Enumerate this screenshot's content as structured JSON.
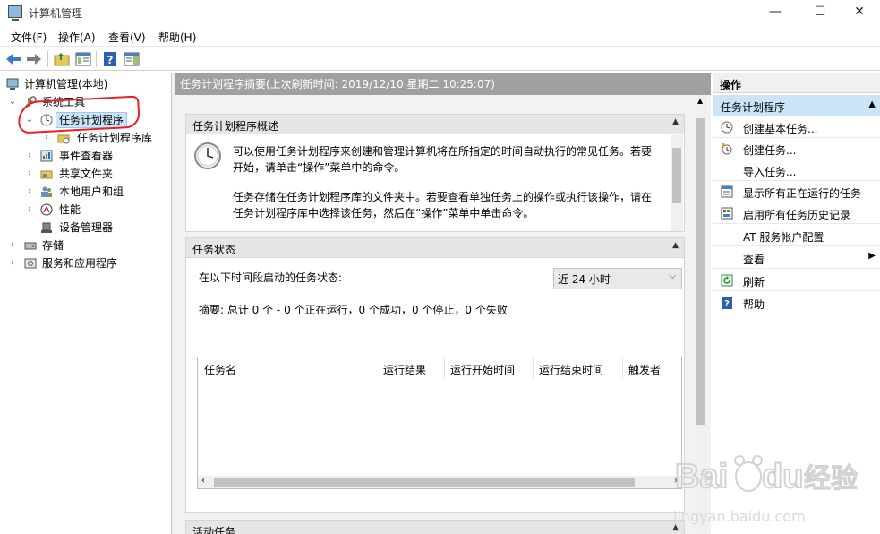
{
  "window": {
    "title": "计算机管理",
    "minimize": "—",
    "maximize": "☐",
    "close": "✕"
  },
  "menu": {
    "file": "文件(F)",
    "action": "操作(A)",
    "view": "查看(V)",
    "help": "帮助(H)"
  },
  "tree": {
    "root": "计算机管理(本地)",
    "system_tools": "系统工具",
    "task_scheduler": "任务计划程序",
    "task_scheduler_library": "任务计划程序库",
    "event_viewer": "事件查看器",
    "shared_folders": "共享文件夹",
    "local_users": "本地用户和组",
    "performance": "性能",
    "device_manager": "设备管理器",
    "storage": "存储",
    "services_apps": "服务和应用程序"
  },
  "center": {
    "header": "任务计划程序摘要(上次刷新时间: 2019/12/10 星期二 10:25:07)",
    "overview": {
      "title": "任务计划程序概述",
      "line1": "可以使用任务计划程序来创建和管理计算机将在所指定的时间自动执行的常见任务。若要",
      "line2": "开始，请单击“操作”菜单中的命令。",
      "line3": "任务存储在任务计划程序库的文件夹中。若要查看单独任务上的操作或执行该操作，请在",
      "line4": "任务计划程序库中选择该任务，然后在“操作”菜单中单击命令。"
    },
    "status": {
      "title": "任务状态",
      "period_label": "在以下时间段启动的任务状态:",
      "period_value": "近 24 小时",
      "summary": "摘要: 总计 0 个 - 0 个正在运行，0 个成功，0 个停止，0 个失败",
      "columns": [
        "任务名",
        "运行结果",
        "运行开始时间",
        "运行结束时间",
        "触发者"
      ]
    },
    "active": {
      "title": "活动任务"
    }
  },
  "actions": {
    "title": "操作",
    "group": "任务计划程序",
    "items": [
      {
        "label": "创建基本任务...",
        "icon": "create-basic-task-icon"
      },
      {
        "label": "创建任务...",
        "icon": "create-task-icon"
      },
      {
        "label": "导入任务...",
        "icon": ""
      },
      {
        "label": "显示所有正在运行的任务",
        "icon": "running-tasks-icon"
      },
      {
        "label": "启用所有任务历史记录",
        "icon": "history-icon"
      },
      {
        "label": "AT 服务帐户配置",
        "icon": ""
      },
      {
        "label": "查看",
        "icon": ""
      },
      {
        "label": "刷新",
        "icon": "refresh-icon"
      },
      {
        "label": "帮助",
        "icon": "help-icon"
      }
    ]
  },
  "watermark": {
    "brand": "Bai",
    "brand2": "du",
    "jingyan": "经验",
    "url": "jingyan.baidu.com"
  },
  "colors": {
    "selection": "#cce4f7",
    "header_gray": "#a0a0a0",
    "annotation_red": "#e8202a"
  }
}
